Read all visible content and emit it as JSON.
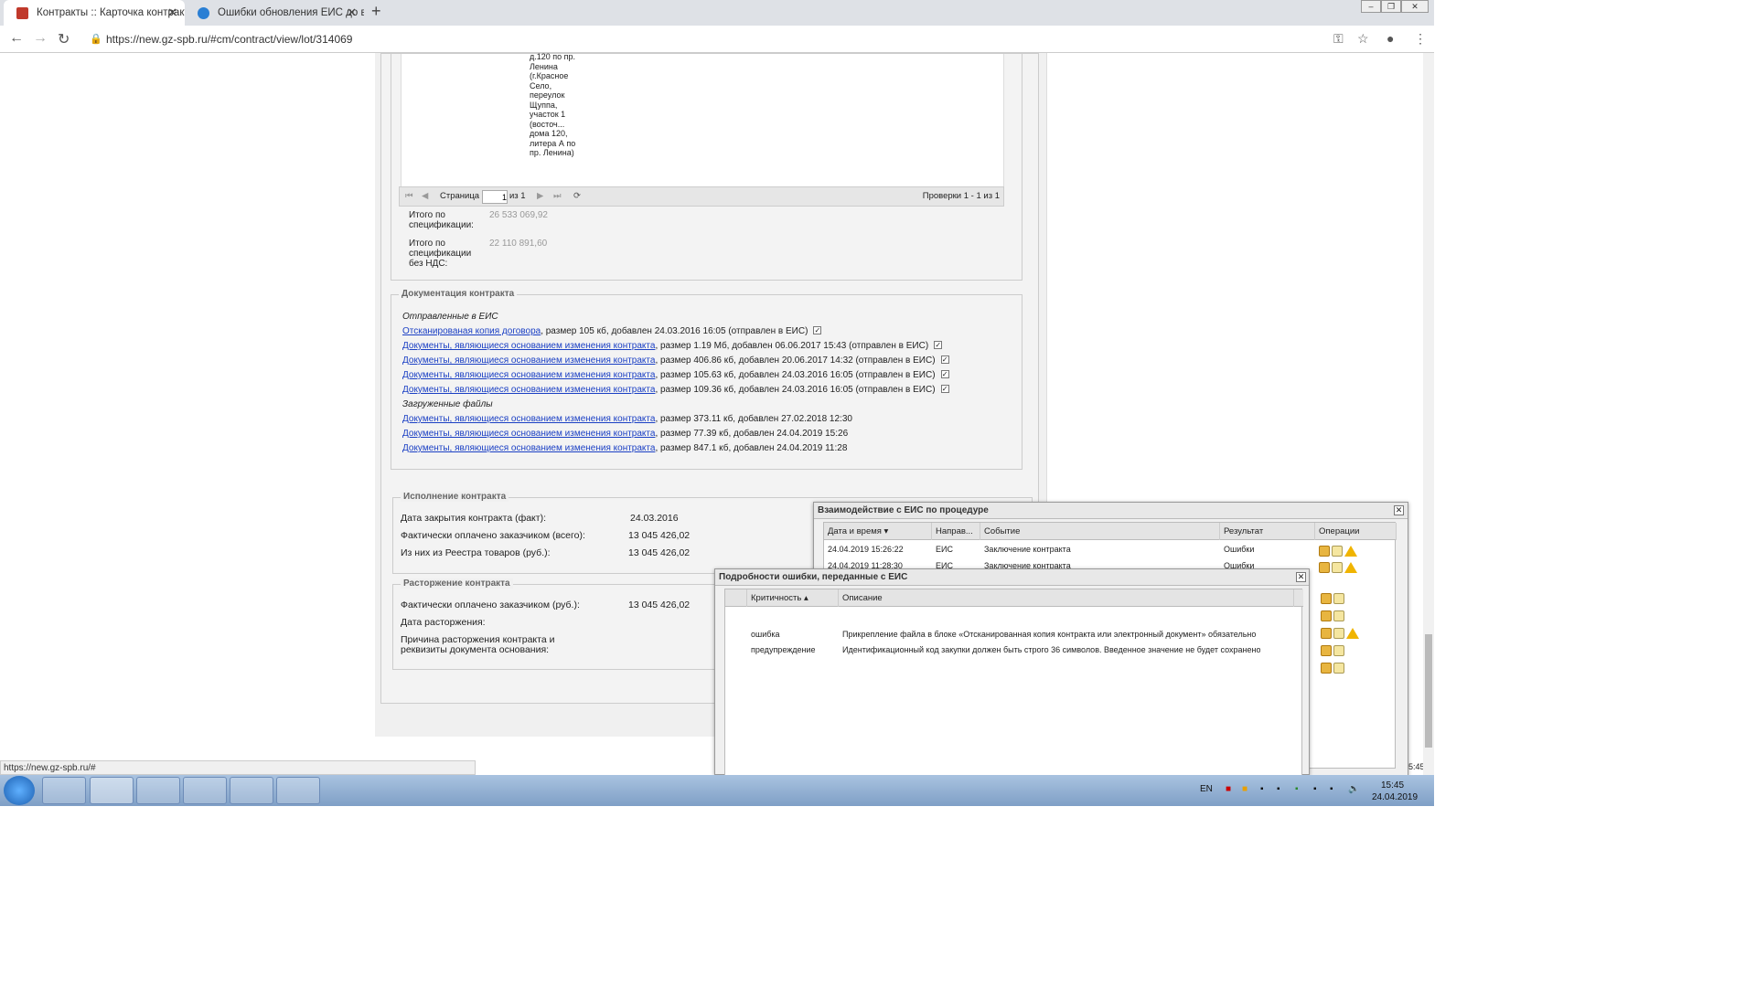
{
  "browser": {
    "tabs": [
      {
        "title": "Контракты :: Карточка контракта",
        "active": true
      },
      {
        "title": "Ошибки обновления ЕИС до версии",
        "active": false
      }
    ],
    "new_tab": "+",
    "url": "https://new.gz-spb.ru/#cm/contract/view/lot/314069",
    "status_url": "https://new.gz-spb.ru/#"
  },
  "spec": {
    "address_cell": "д.120 по пр. Ленина (г.Красное Село, переулок Щуппа, участок 1 (восточ... дома 120, литера А по пр. Ленина)",
    "pager": {
      "page_label": "Страница",
      "page_value": "1",
      "of_label": "из 1",
      "summary": "Проверки 1 - 1 из 1"
    },
    "total_label": "Итого по спецификации:",
    "total_value": "26 533 069,92",
    "total_novat_label": "Итого по спецификации без НДС:",
    "total_novat_value": "22 110 891,60"
  },
  "docs": {
    "legend": "Документация контракта",
    "sent_header": "Отправленные в ЕИС",
    "sent": [
      {
        "link": "Отсканированая копия договора",
        "meta": ", размер 105 кб, добавлен 24.03.2016 16:05 (отправлен в ЕИС)"
      },
      {
        "link": "Документы, являющиеся основанием изменения контракта",
        "meta": ", размер 1.19 Мб, добавлен 06.06.2017 15:43 (отправлен в ЕИС)"
      },
      {
        "link": "Документы, являющиеся основанием изменения контракта",
        "meta": ", размер 406.86 кб, добавлен 20.06.2017 14:32 (отправлен в ЕИС)"
      },
      {
        "link": "Документы, являющиеся основанием изменения контракта",
        "meta": ", размер 105.63 кб, добавлен 24.03.2016 16:05 (отправлен в ЕИС)"
      },
      {
        "link": "Документы, являющиеся основанием изменения контракта",
        "meta": ", размер 109.36 кб, добавлен 24.03.2016 16:05 (отправлен в ЕИС)"
      }
    ],
    "uploaded_header": "Загруженные файлы",
    "uploaded": [
      {
        "link": "Документы, являющиеся основанием изменения контракта",
        "meta": ", размер 373.11 кб, добавлен 27.02.2018 12:30"
      },
      {
        "link": "Документы, являющиеся основанием изменения контракта",
        "meta": ", размер 77.39 кб, добавлен 24.04.2019 15:26"
      },
      {
        "link": "Документы, являющиеся основанием изменения контракта",
        "meta": ", размер 847.1 кб, добавлен 24.04.2019 11:28"
      }
    ]
  },
  "execution": {
    "legend": "Исполнение контракта",
    "rows": [
      {
        "label": "Дата закрытия контракта (факт):",
        "value": "24.03.2016"
      },
      {
        "label": "Фактически оплачено заказчиком (всего):",
        "value": "13 045 426,02"
      },
      {
        "label": "Из них из Реестра товаров (руб.):",
        "value": "13 045 426,02"
      }
    ]
  },
  "termination": {
    "legend": "Расторжение контракта",
    "rows": [
      {
        "label": "Фактически оплачено заказчиком (руб.):",
        "value": "13 045 426,02"
      },
      {
        "label": "Дата расторжения:",
        "value": ""
      },
      {
        "label": "Причина расторжения контракта и реквизиты документа основания:",
        "value": ""
      }
    ]
  },
  "eis_dialog": {
    "title": "Взаимодействие с ЕИС по процедуре",
    "columns": [
      "Дата и время",
      "Направ...",
      "Событие",
      "Результат",
      "Операции"
    ],
    "rows": [
      {
        "date": "24.04.2019 15:26:22",
        "dir": "ЕИС",
        "event": "Заключение контракта",
        "result": "Ошибки",
        "warn": true
      },
      {
        "date": "24.04.2019 11:28:30",
        "dir": "ЕИС",
        "event": "Заключение контракта",
        "result": "Ошибки",
        "warn": true
      }
    ],
    "side_time": "5:45"
  },
  "error_dialog": {
    "title": "Подробности ошибки, переданные с ЕИС",
    "columns": [
      "Критичность",
      "Описание"
    ],
    "rows": [
      {
        "level": "ошибка",
        "desc": "Прикрепление файла в блоке «Отсканированная копия контракта или электронный документ» обязательно"
      },
      {
        "level": "предупреждение",
        "desc": "Идентификационный код закупки должен быть строго 36 символов. Введенное значение не будет сохранено"
      }
    ]
  },
  "taskbar": {
    "lang": "EN",
    "time": "15:45",
    "date": "24.04.2019"
  }
}
